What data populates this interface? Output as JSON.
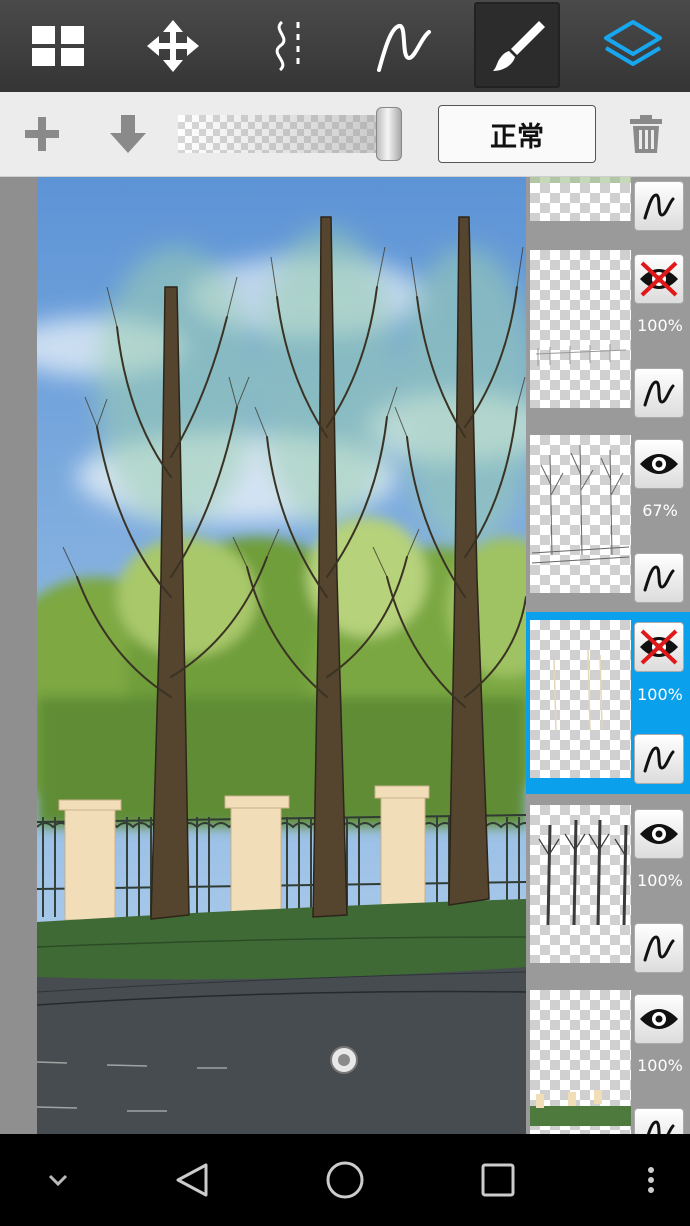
{
  "toolbar": {
    "tools": [
      {
        "name": "grid-menu-icon"
      },
      {
        "name": "move-icon"
      },
      {
        "name": "ruler-icon"
      },
      {
        "name": "pen-icon"
      },
      {
        "name": "brush-icon",
        "selected": true
      },
      {
        "name": "layers-icon"
      }
    ]
  },
  "layer_bar": {
    "add_icon": "plus-icon",
    "merge_down_icon": "arrow-down-icon",
    "opacity_fraction": 0.92,
    "blend_mode_label": "正常",
    "delete_icon": "trash-icon"
  },
  "layers": [
    {
      "visible": null,
      "opacity": "",
      "thumb": "partial-top"
    },
    {
      "visible": false,
      "opacity": "100%",
      "thumb": "fence-sketch"
    },
    {
      "visible": true,
      "opacity": "67%",
      "thumb": "tree-lineart"
    },
    {
      "visible": false,
      "opacity": "100%",
      "thumb": "faint-branches",
      "selected": true
    },
    {
      "visible": true,
      "opacity": "100%",
      "thumb": "tree-trunks"
    },
    {
      "visible": true,
      "opacity": "100%",
      "thumb": "fence-ground"
    }
  ],
  "navbar": {
    "buttons": [
      "chevron-down-icon",
      "back-icon",
      "home-icon",
      "recents-icon",
      "overflow-menu-icon"
    ]
  },
  "colors": {
    "accent": "#0aa0ec",
    "toolbar_bg": "#3d3d3d",
    "hidden_x": "#e01818"
  }
}
